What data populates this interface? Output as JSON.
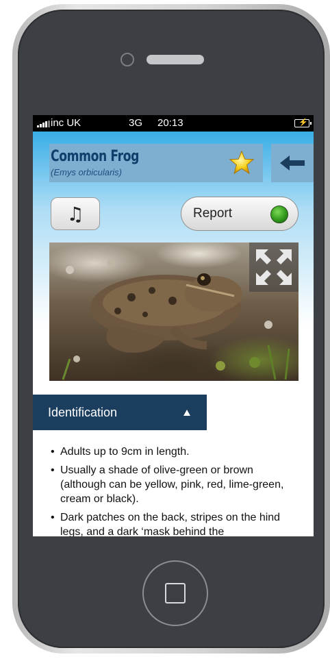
{
  "status_bar": {
    "carrier": "inc UK",
    "network": "3G",
    "time": "20:13"
  },
  "species": {
    "common_name": "Common Frog",
    "latin_name": "(Emys orbicularis)",
    "favorite_icon": "star-icon",
    "back_icon": "back-arrow-icon"
  },
  "actions": {
    "audio_icon": "music-note-icon",
    "report_label": "Report",
    "report_status_color": "#3fae25"
  },
  "photo": {
    "expand_icon": "expand-icon"
  },
  "section": {
    "title": "Identification",
    "toggle_icon": "collapse-triangle-icon",
    "bullets": [
      "Adults up to 9cm in length.",
      "Usually a shade of olive-green or brown (although can be yellow, pink, red, lime-green, cream or black).",
      "Dark patches on the back, stripes on the hind legs, and a dark ‘mask behind the"
    ]
  },
  "colors": {
    "header_blue": "#7eaed0",
    "title_navy": "#0f3f6b",
    "section_navy": "#1b3d5e"
  }
}
